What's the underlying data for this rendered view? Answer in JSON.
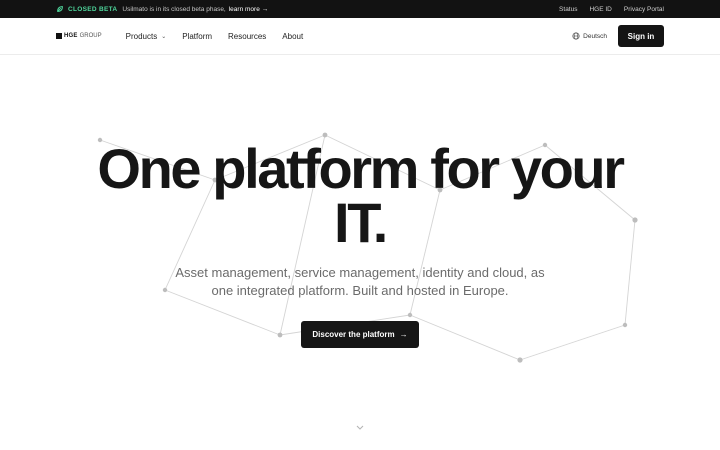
{
  "topbar": {
    "beta_tag": "CLOSED BETA",
    "beta_message": "Usilmato is in its closed beta phase,",
    "learn_more": "learn more →",
    "links": [
      "Status",
      "HGE ID",
      "Privacy Portal"
    ]
  },
  "nav": {
    "logo_bold": "HGE",
    "logo_light": "GROUP",
    "products": "Products",
    "platform": "Platform",
    "resources": "Resources",
    "about": "About",
    "language": "Deutsch",
    "sign_in": "Sign in"
  },
  "hero": {
    "title_line1": "One platform for your",
    "title_line2": "IT.",
    "subtitle_line1": "Asset management, service management, identity and cloud, as",
    "subtitle_line2": "one integrated platform. Built and hosted in Europe.",
    "cta_label": "Discover the platform",
    "cta_arrow": "→"
  },
  "icons": {
    "beta": "leaf-icon",
    "products_chevron": "chevron-down-icon",
    "language": "globe-icon",
    "scroll": "chevron-down-icon"
  },
  "colors": {
    "topbar_bg": "#121212",
    "beta_accent": "#4fd69c",
    "button_bg": "#161616",
    "network_line": "#d4d4d4",
    "network_node": "#bdbdbd"
  }
}
